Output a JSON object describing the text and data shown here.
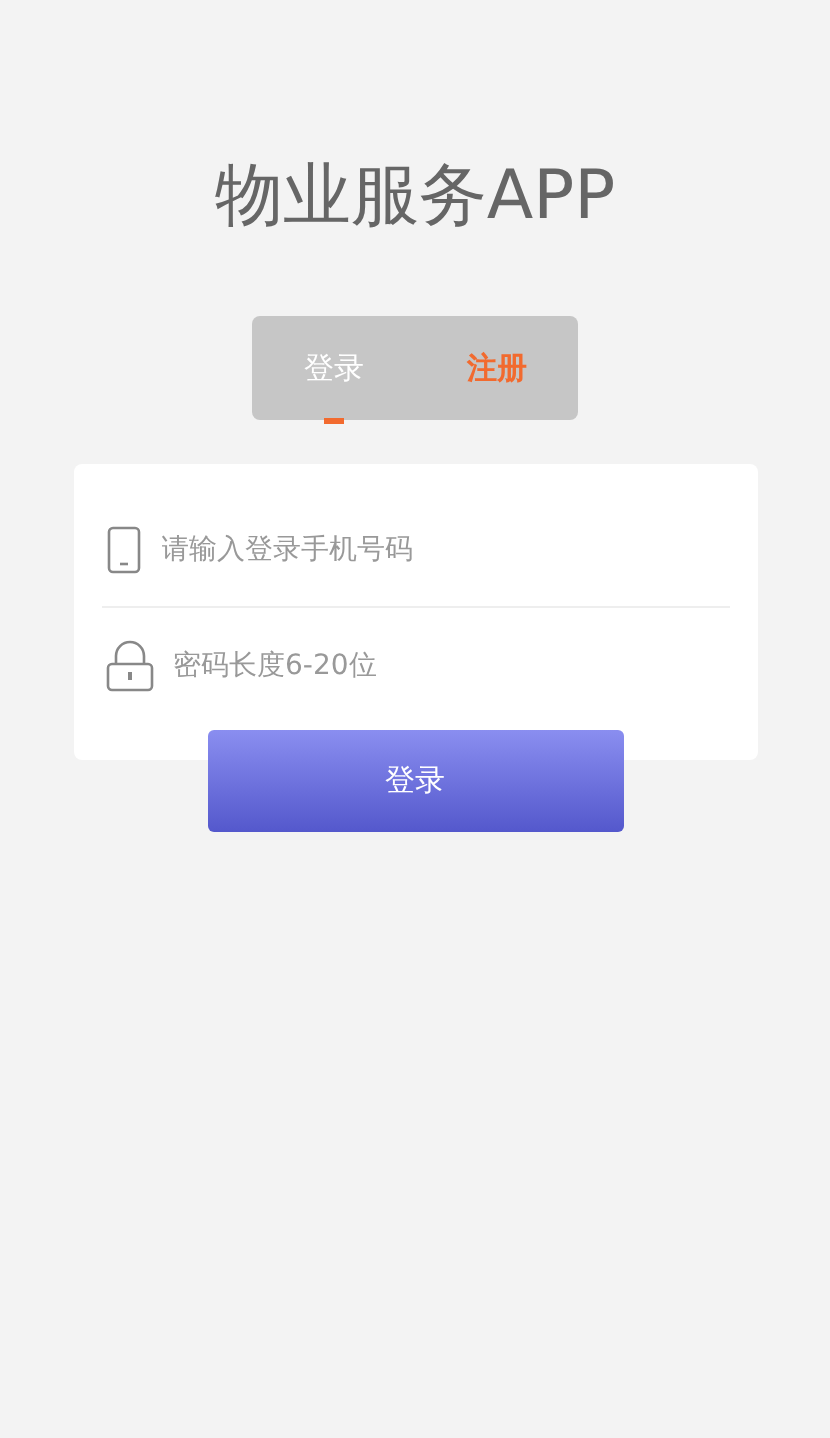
{
  "title": "物业服务APP",
  "tabs": [
    {
      "label": "登录",
      "selected": true
    },
    {
      "label": "注册",
      "selected": false
    }
  ],
  "fields": [
    {
      "kind": "phone",
      "placeholder": "请输入登录手机号码"
    },
    {
      "kind": "password",
      "placeholder": "密码长度6-20位"
    }
  ],
  "submit": "登录"
}
